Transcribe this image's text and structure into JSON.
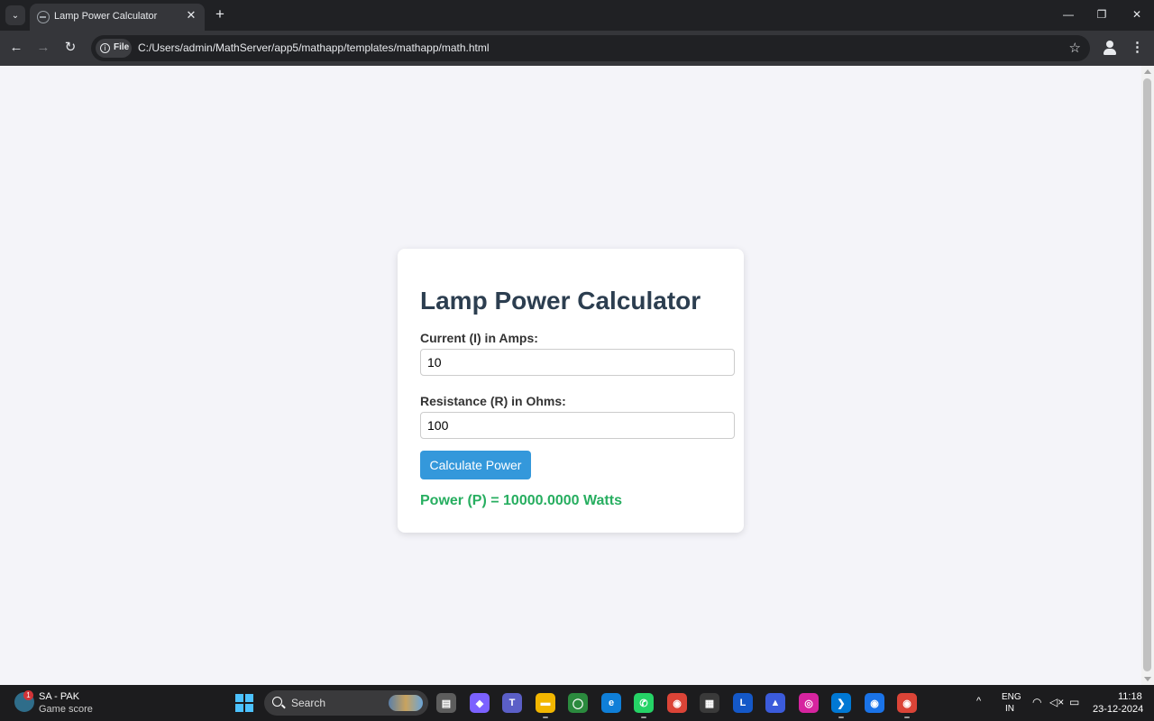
{
  "browser": {
    "tab_title": "Lamp Power Calculator",
    "tab_close": "✕",
    "new_tab": "+",
    "address_chip": "File",
    "url": "C:/Users/admin/MathServer/app5/mathapp/templates/mathapp/math.html",
    "window_controls": {
      "minimize": "—",
      "restore": "❐",
      "close": "✕"
    },
    "nav": {
      "back": "←",
      "forward": "→",
      "reload": "↻",
      "tab_search": "⌄"
    },
    "star": "☆",
    "menu": "⋮"
  },
  "page": {
    "title": "Lamp Power Calculator",
    "current_label": "Current (I) in Amps:",
    "current_value": "10",
    "resistance_label": "Resistance (R) in Ohms:",
    "resistance_value": "100",
    "button_label": "Calculate Power",
    "result": "Power (P) = 10000.0000 Watts",
    "colors": {
      "heading": "#2c3e50",
      "button": "#3498db",
      "result": "#27ae60",
      "background": "#f4f4f9"
    }
  },
  "taskbar": {
    "weather_badge": "1",
    "weather_title": "SA - PAK",
    "weather_subtitle": "Game score",
    "search_label": "Search",
    "apps": [
      {
        "name": "file-explorer-icon",
        "glyph": "▤",
        "color": "#5d5d5d"
      },
      {
        "name": "copilot-icon",
        "glyph": "◆",
        "color": "#7b61ff"
      },
      {
        "name": "teams-icon",
        "glyph": "T",
        "color": "#5b5fc7"
      },
      {
        "name": "folder-icon",
        "glyph": "▬",
        "color": "#f2b600"
      },
      {
        "name": "ring-app-icon",
        "glyph": "◯",
        "color": "#2b8a3e"
      },
      {
        "name": "edge-icon",
        "glyph": "e",
        "color": "#0f7fd8"
      },
      {
        "name": "whatsapp-icon",
        "glyph": "✆",
        "color": "#25d366"
      },
      {
        "name": "chrome-icon",
        "glyph": "◉",
        "color": "#db4437"
      },
      {
        "name": "store-icon",
        "glyph": "▦",
        "color": "#3a3a3a"
      },
      {
        "name": "l-app-icon",
        "glyph": "L",
        "color": "#1458c8"
      },
      {
        "name": "arc-app-icon",
        "glyph": "▲",
        "color": "#3b5bdb"
      },
      {
        "name": "instagram-icon",
        "glyph": "◎",
        "color": "#d6249f"
      },
      {
        "name": "vscode-icon",
        "glyph": "❯",
        "color": "#0078d4"
      },
      {
        "name": "chrome-dev-icon",
        "glyph": "◉",
        "color": "#1a73e8"
      },
      {
        "name": "chrome-active-icon",
        "glyph": "◉",
        "color": "#db4437"
      }
    ],
    "tray_chevron": "^",
    "lang_line1": "ENG",
    "lang_line2": "IN",
    "time": "11:18",
    "date": "23-12-2024"
  }
}
